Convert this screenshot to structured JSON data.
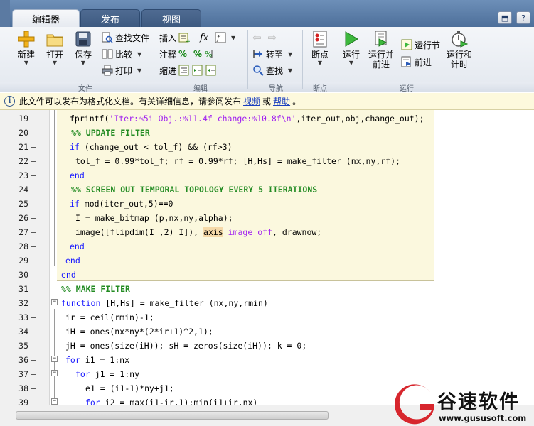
{
  "tabs": [
    {
      "label": "编辑器",
      "active": true
    },
    {
      "label": "发布",
      "active": false
    },
    {
      "label": "视图",
      "active": false
    }
  ],
  "window_buttons": [
    {
      "icon": "quick-access-icon",
      "glyph": "⬒"
    },
    {
      "icon": "help-icon",
      "glyph": "?"
    }
  ],
  "ribbon": {
    "file": {
      "label": "文件",
      "new": "新建",
      "open": "打开",
      "save": "保存",
      "find_files": "查找文件",
      "compare": "比较",
      "print": "打印"
    },
    "edit": {
      "label": "编辑",
      "insert": "插入",
      "comment": "注释",
      "indent": "缩进",
      "fx": "fx"
    },
    "navigate": {
      "label": "导航",
      "goto": "转至",
      "find": "查找"
    },
    "breakpoints": {
      "label": "断点",
      "breakpoints": "断点"
    },
    "run": {
      "label": "运行",
      "run": "运行",
      "run_advance_line1": "运行并",
      "run_advance_line2": "前进",
      "run_section": "运行节",
      "advance": "前进",
      "run_time_line1": "运行和",
      "run_time_line2": "计时"
    }
  },
  "infobar": {
    "text": "此文件可以发布为格式化文档。有关详细信息，请参阅发布",
    "link_video": "视频",
    "or": "或",
    "link_help": "帮助",
    "end": "。"
  },
  "editor": {
    "lines": [
      {
        "num": "19",
        "dash": "–",
        "text": "fprintf('Iter:%5i Obj.:%11.4f change:%10.8f\\n',iter_out,obj,change_out);"
      },
      {
        "num": "20",
        "dash": "",
        "text": "%% UPDATE FILTER"
      },
      {
        "num": "21",
        "dash": "–",
        "text": "if (change_out < tol_f) && (rf>3)"
      },
      {
        "num": "22",
        "dash": "–",
        "text": "tol_f = 0.99*tol_f; rf = 0.99*rf; [H,Hs] = make_filter (nx,ny,rf);"
      },
      {
        "num": "23",
        "dash": "–",
        "text": "end"
      },
      {
        "num": "24",
        "dash": "",
        "text": "%% SCREEN OUT TEMPORAL TOPOLOGY EVERY 5 ITERATIONS"
      },
      {
        "num": "25",
        "dash": "–",
        "text": "if mod(iter_out,5)==0"
      },
      {
        "num": "26",
        "dash": "–",
        "text": "I = make_bitmap (p,nx,ny,alpha);"
      },
      {
        "num": "27",
        "dash": "–",
        "text": "image([flipdim(I ,2) I]), axis image off, drawnow;"
      },
      {
        "num": "28",
        "dash": "–",
        "text": "end"
      },
      {
        "num": "29",
        "dash": "–",
        "text": "end"
      },
      {
        "num": "30",
        "dash": "–",
        "text": "end"
      },
      {
        "num": "31",
        "dash": "",
        "text": "%% MAKE FILTER"
      },
      {
        "num": "32",
        "dash": "",
        "text": "function [H,Hs] = make_filter (nx,ny,rmin)"
      },
      {
        "num": "33",
        "dash": "–",
        "text": "ir = ceil(rmin)-1;"
      },
      {
        "num": "34",
        "dash": "–",
        "text": "iH = ones(nx*ny*(2*ir+1)^2,1);"
      },
      {
        "num": "35",
        "dash": "–",
        "text": "jH = ones(size(iH)); sH = zeros(size(iH)); k = 0;"
      },
      {
        "num": "36",
        "dash": "–",
        "text": "for i1 = 1:nx"
      },
      {
        "num": "37",
        "dash": "–",
        "text": "for j1 = 1:ny"
      },
      {
        "num": "38",
        "dash": "–",
        "text": "e1 = (i1-1)*ny+j1;"
      },
      {
        "num": "39",
        "dash": "–",
        "text": "for i2 = max(i1-ir,1):min(i1+ir,nx)"
      }
    ]
  },
  "watermark": {
    "name": "谷速软件",
    "url": "www.gususoft.com"
  },
  "colors": {
    "keyword": "#1a1aff",
    "string": "#a020f0",
    "comment": "#228b22",
    "cell_background": "#fbf8de",
    "tab_bar": "#4d6f9a",
    "watermark_red": "#d7262d"
  }
}
